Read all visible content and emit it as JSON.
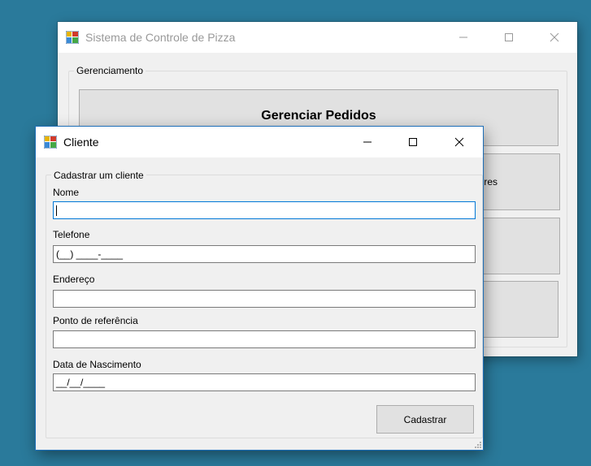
{
  "main_window": {
    "title": "Sistema de Controle de Pizza",
    "group_label": "Gerenciamento",
    "buttons": [
      {
        "label": "Gerenciar Pedidos"
      },
      {
        "label": "res"
      },
      {
        "label": ""
      },
      {
        "label": ""
      }
    ]
  },
  "dialog": {
    "title": "Cliente",
    "group_label": "Cadastrar um cliente",
    "fields": {
      "nome": {
        "label": "Nome",
        "value": ""
      },
      "telefone": {
        "label": "Telefone",
        "value": "(__) ____-____"
      },
      "endereco": {
        "label": "Endereço",
        "value": ""
      },
      "ponto_referencia": {
        "label": "Ponto de referência",
        "value": ""
      },
      "data_nascimento": {
        "label": "Data de Nascimento",
        "value": "__/__/____"
      }
    },
    "submit_label": "Cadastrar"
  },
  "icons": {
    "app": "app-form-icon",
    "minimize": "minimize-icon",
    "maximize": "maximize-icon",
    "close": "close-icon",
    "resize": "resize-grip-icon"
  },
  "colors": {
    "desktop": "#2a7a9b",
    "window": "#f0f0f0",
    "focus_border": "#0078d7"
  }
}
